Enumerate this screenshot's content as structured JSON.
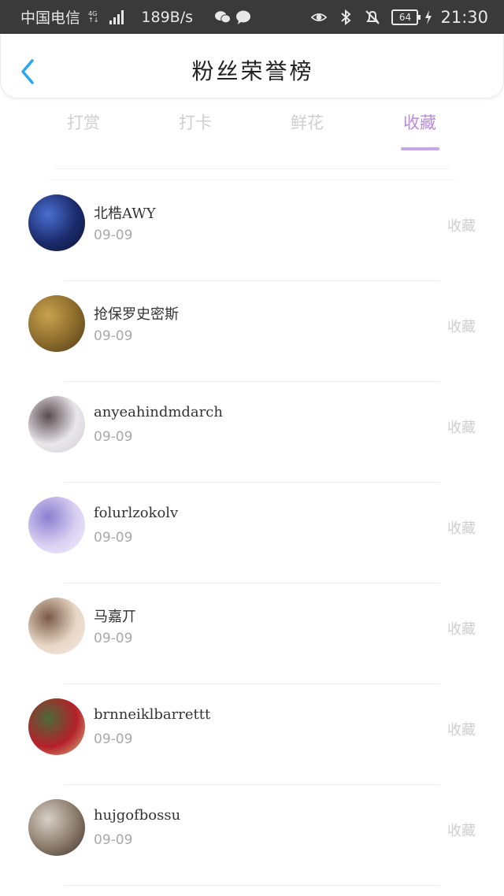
{
  "status_bar": {
    "carrier": "中国电信",
    "network_top": "4G",
    "network_bottom": "↑↓",
    "speed": "189B/s",
    "battery": "64",
    "time": "21:30"
  },
  "header": {
    "title": "粉丝荣誉榜"
  },
  "tabs": [
    {
      "label": "打赏"
    },
    {
      "label": "打卡"
    },
    {
      "label": "鲜花"
    },
    {
      "label": "收藏"
    }
  ],
  "active_tab": "收藏",
  "colors": {
    "accent": "#b98bd8",
    "back_arrow": "#2aa7f0"
  },
  "list": [
    {
      "name": "北梏AWY",
      "date": "09-09",
      "action": "收藏",
      "avatar_colors": [
        "#1b2a6b",
        "#4a6fd0",
        "#0c1533"
      ]
    },
    {
      "name": "抢保罗史密斯",
      "date": "09-09",
      "action": "收藏",
      "avatar_colors": [
        "#8a6a2b",
        "#c9a24e",
        "#4d3a1a"
      ]
    },
    {
      "name": "anyeahindmdarch",
      "date": "09-09",
      "action": "收藏",
      "avatar_colors": [
        "#e9e6ea",
        "#5a4b4e",
        "#cfcfd8"
      ]
    },
    {
      "name": "folurlzokolv",
      "date": "09-09",
      "action": "收藏",
      "avatar_colors": [
        "#d9d0f2",
        "#8a7fd0",
        "#f5f0ff"
      ]
    },
    {
      "name": "马嘉丌",
      "date": "09-09",
      "action": "收藏",
      "avatar_colors": [
        "#e8d7c6",
        "#7a5a46",
        "#f3ebe2"
      ]
    },
    {
      "name": "brnneiklbarrettt",
      "date": "09-09",
      "action": "收藏",
      "avatar_colors": [
        "#b5202a",
        "#4a6b3a",
        "#d9c28a"
      ]
    },
    {
      "name": "hujgofbossu",
      "date": "09-09",
      "action": "收藏",
      "avatar_colors": [
        "#8a7a6a",
        "#d8d0c6",
        "#3a3028"
      ]
    }
  ]
}
